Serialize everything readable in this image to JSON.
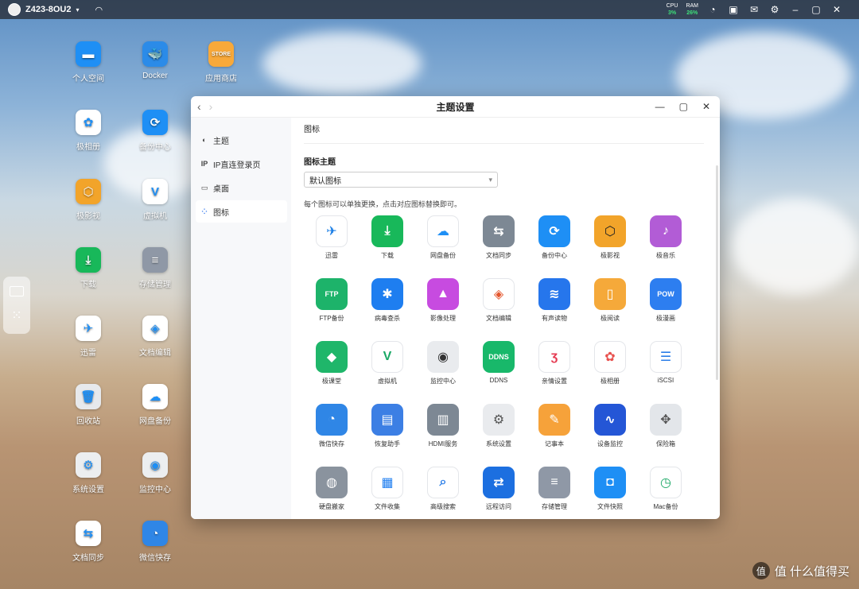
{
  "topbar": {
    "device_name": "Z423-8OU2",
    "cpu_label": "CPU",
    "cpu_value": "3%",
    "ram_label": "RAM",
    "ram_value": "26%"
  },
  "desktop": [
    {
      "label": "个人空间",
      "icon": "folder-icon",
      "color": "#1e8ff5",
      "glyph": "▬"
    },
    {
      "label": "Docker",
      "icon": "docker-icon",
      "color": "#2b8be8",
      "glyph": "🐳"
    },
    {
      "label": "应用商店",
      "icon": "store-icon",
      "color": "#f8a93a",
      "glyph": "STORE"
    },
    {
      "label": "极相册",
      "icon": "photos-icon",
      "color": "#ffffff",
      "glyph": "✿"
    },
    {
      "label": "备份中心",
      "icon": "backup-center-icon",
      "color": "#1e8ff5",
      "glyph": "⟳"
    },
    {
      "label": "极影视",
      "icon": "video-icon",
      "color": "#f2a42a",
      "glyph": "⬡"
    },
    {
      "label": "虚拟机",
      "icon": "vm-icon",
      "color": "#ffffff",
      "glyph": "V"
    },
    {
      "label": "下载",
      "icon": "download-icon",
      "color": "#18b85a",
      "glyph": "⤓"
    },
    {
      "label": "存储管理",
      "icon": "storage-icon",
      "color": "#8f98a6",
      "glyph": "≡"
    },
    {
      "label": "迅雷",
      "icon": "thunder-icon",
      "color": "#ffffff",
      "glyph": "✈"
    },
    {
      "label": "文档编辑",
      "icon": "doc-edit-icon",
      "color": "#ffffff",
      "glyph": "◈"
    },
    {
      "label": "回收站",
      "icon": "trash-icon",
      "color": "#e7e9ec",
      "glyph": "🗑"
    },
    {
      "label": "网盘备份",
      "icon": "cloud-backup-icon",
      "color": "#ffffff",
      "glyph": "☁"
    },
    {
      "label": "系统设置",
      "icon": "settings-icon",
      "color": "#eceef0",
      "glyph": "⚙"
    },
    {
      "label": "监控中心",
      "icon": "camera-icon",
      "color": "#eceef0",
      "glyph": "◉"
    },
    {
      "label": "文档同步",
      "icon": "sync-icon",
      "color": "#ffffff",
      "glyph": "⇆"
    },
    {
      "label": "微信快存",
      "icon": "wechat-icon",
      "color": "#2f86e6",
      "glyph": "◔"
    }
  ],
  "window": {
    "title": "主题设置",
    "sidebar": [
      {
        "label": "主题",
        "icon": "theme-icon",
        "glyph": "◐"
      },
      {
        "label": "IP直连登录页",
        "icon": "ip-icon",
        "glyph": "IP"
      },
      {
        "label": "桌面",
        "icon": "desktop-icon",
        "glyph": "▭"
      },
      {
        "label": "图标",
        "icon": "icons-icon",
        "glyph": "⁘"
      }
    ],
    "section_title": "图标",
    "theme_label": "图标主题",
    "theme_value": "默认图标",
    "hint": "每个图标可以单独更换，点击对应图标替换即可。",
    "icons": [
      {
        "label": "迅雷",
        "icon": "thunder-icon",
        "color": "#ffffff",
        "fg": "#1a7ee6",
        "glyph": "✈"
      },
      {
        "label": "下载",
        "icon": "download-icon",
        "color": "#18b85a",
        "fg": "#fff",
        "glyph": "⤓"
      },
      {
        "label": "网盘备份",
        "icon": "cloud-backup-icon",
        "color": "#ffffff",
        "fg": "#1e8ff5",
        "glyph": "☁"
      },
      {
        "label": "文档同步",
        "icon": "sync-icon",
        "color": "#7d8894",
        "fg": "#fff",
        "glyph": "⇆"
      },
      {
        "label": "备份中心",
        "icon": "backup-center-icon",
        "color": "#1e8ff5",
        "fg": "#fff",
        "glyph": "⟳"
      },
      {
        "label": "极影视",
        "icon": "video-icon",
        "color": "#f2a42a",
        "fg": "#222",
        "glyph": "⬡"
      },
      {
        "label": "极音乐",
        "icon": "music-icon",
        "color": "#b25cd6",
        "fg": "#fff",
        "glyph": "♪"
      },
      {
        "label": "FTP备份",
        "icon": "ftp-icon",
        "color": "#1db36a",
        "fg": "#fff",
        "glyph": "FTP"
      },
      {
        "label": "病毒查杀",
        "icon": "antivirus-icon",
        "color": "#1e7ef0",
        "fg": "#fff",
        "glyph": "✱"
      },
      {
        "label": "影像处理",
        "icon": "image-icon",
        "color": "#c74be0",
        "fg": "#fff",
        "glyph": "▲"
      },
      {
        "label": "文档编辑",
        "icon": "doc-edit-icon",
        "color": "#ffffff",
        "fg": "#e4572e",
        "glyph": "◈"
      },
      {
        "label": "有声读物",
        "icon": "audiobook-icon",
        "color": "#2676ec",
        "fg": "#fff",
        "glyph": "≋"
      },
      {
        "label": "极阅读",
        "icon": "reader-icon",
        "color": "#f5a93a",
        "fg": "#fff",
        "glyph": "▯"
      },
      {
        "label": "极漫画",
        "icon": "comic-icon",
        "color": "#2d7ef0",
        "fg": "#fff",
        "glyph": "POW"
      },
      {
        "label": "极课堂",
        "icon": "classroom-icon",
        "color": "#1fb66a",
        "fg": "#fff",
        "glyph": "◆"
      },
      {
        "label": "虚拟机",
        "icon": "vm-icon",
        "color": "#ffffff",
        "fg": "#1aa865",
        "glyph": "V"
      },
      {
        "label": "监控中心",
        "icon": "camera-icon",
        "color": "#e9ebee",
        "fg": "#333",
        "glyph": "◉"
      },
      {
        "label": "DDNS",
        "icon": "ddns-icon",
        "color": "#18b86a",
        "fg": "#fff",
        "glyph": "DDNS"
      },
      {
        "label": "亲情设置",
        "icon": "family-icon",
        "color": "#ffffff",
        "fg": "#e53950",
        "glyph": "ʒ"
      },
      {
        "label": "极相册",
        "icon": "photos-icon",
        "color": "#ffffff",
        "fg": "#e8514e",
        "glyph": "✿"
      },
      {
        "label": "iSCSI",
        "icon": "iscsi-icon",
        "color": "#ffffff",
        "fg": "#2b7ee8",
        "glyph": "☰"
      },
      {
        "label": "微信快存",
        "icon": "wechat-icon",
        "color": "#2f86e6",
        "fg": "#fff",
        "glyph": "◔"
      },
      {
        "label": "恢复助手",
        "icon": "recovery-icon",
        "color": "#3c7fe4",
        "fg": "#fff",
        "glyph": "▤"
      },
      {
        "label": "HDMI服务",
        "icon": "hdmi-icon",
        "color": "#7d8894",
        "fg": "#fff",
        "glyph": "▥"
      },
      {
        "label": "系统设置",
        "icon": "settings-icon",
        "color": "#e9ebee",
        "fg": "#555",
        "glyph": "⚙"
      },
      {
        "label": "记事本",
        "icon": "notepad-icon",
        "color": "#f6a23a",
        "fg": "#fff",
        "glyph": "✎"
      },
      {
        "label": "设备监控",
        "icon": "monitor-icon",
        "color": "#2456d6",
        "fg": "#fff",
        "glyph": "∿"
      },
      {
        "label": "保险箱",
        "icon": "safe-icon",
        "color": "#e3e6ea",
        "fg": "#555",
        "glyph": "✥"
      },
      {
        "label": "硬盘搬家",
        "icon": "disk-move-icon",
        "color": "#8a939e",
        "fg": "#fff",
        "glyph": "◍"
      },
      {
        "label": "文件收集",
        "icon": "file-collect-icon",
        "color": "#ffffff",
        "fg": "#1e7ef0",
        "glyph": "▦"
      },
      {
        "label": "高级搜索",
        "icon": "search-icon",
        "color": "#ffffff",
        "fg": "#2b7ee8",
        "glyph": "⌕"
      },
      {
        "label": "远程访问",
        "icon": "remote-icon",
        "color": "#1c6fe0",
        "fg": "#fff",
        "glyph": "⇄"
      },
      {
        "label": "存储管理",
        "icon": "storage-icon",
        "color": "#8f98a6",
        "fg": "#fff",
        "glyph": "≡"
      },
      {
        "label": "文件快照",
        "icon": "snapshot-icon",
        "color": "#1e8ff5",
        "fg": "#fff",
        "glyph": "◘"
      },
      {
        "label": "Mac备份",
        "icon": "mac-backup-icon",
        "color": "#ffffff",
        "fg": "#1aa865",
        "glyph": "◷"
      }
    ]
  },
  "watermark": "值 什么值得买"
}
